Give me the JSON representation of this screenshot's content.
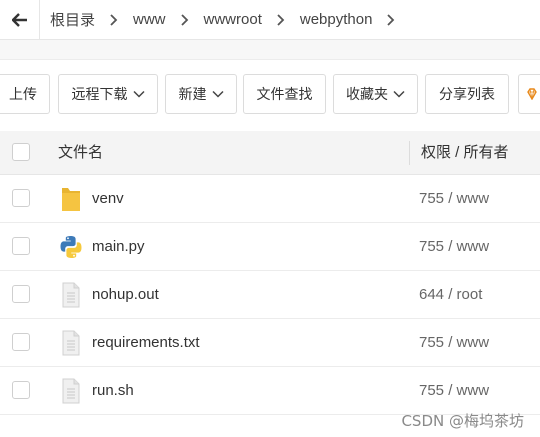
{
  "breadcrumb": {
    "items": [
      "根目录",
      "www",
      "wwwroot",
      "webpython"
    ]
  },
  "toolbar": {
    "upload": "上传",
    "remote_download": "远程下载",
    "new": "新建",
    "file_search": "文件查找",
    "favorites": "收藏夹",
    "share_list": "分享列表"
  },
  "table": {
    "col_name": "文件名",
    "col_perm": "权限 / 所有者",
    "rows": [
      {
        "name": "venv",
        "perm": "755 / www",
        "icon": "folder-icon"
      },
      {
        "name": "main.py",
        "perm": "755 / www",
        "icon": "python-file-icon"
      },
      {
        "name": "nohup.out",
        "perm": "644 / root",
        "icon": "file-icon"
      },
      {
        "name": "requirements.txt",
        "perm": "755 / www",
        "icon": "file-icon"
      },
      {
        "name": "run.sh",
        "perm": "755 / www",
        "icon": "file-icon"
      }
    ]
  },
  "watermark": "CSDN @梅坞茶坊",
  "colors": {
    "folder": "#f5c441",
    "python_blue": "#3d7ab8",
    "python_yellow": "#f6c93c",
    "accent_orange": "#e8891b"
  }
}
